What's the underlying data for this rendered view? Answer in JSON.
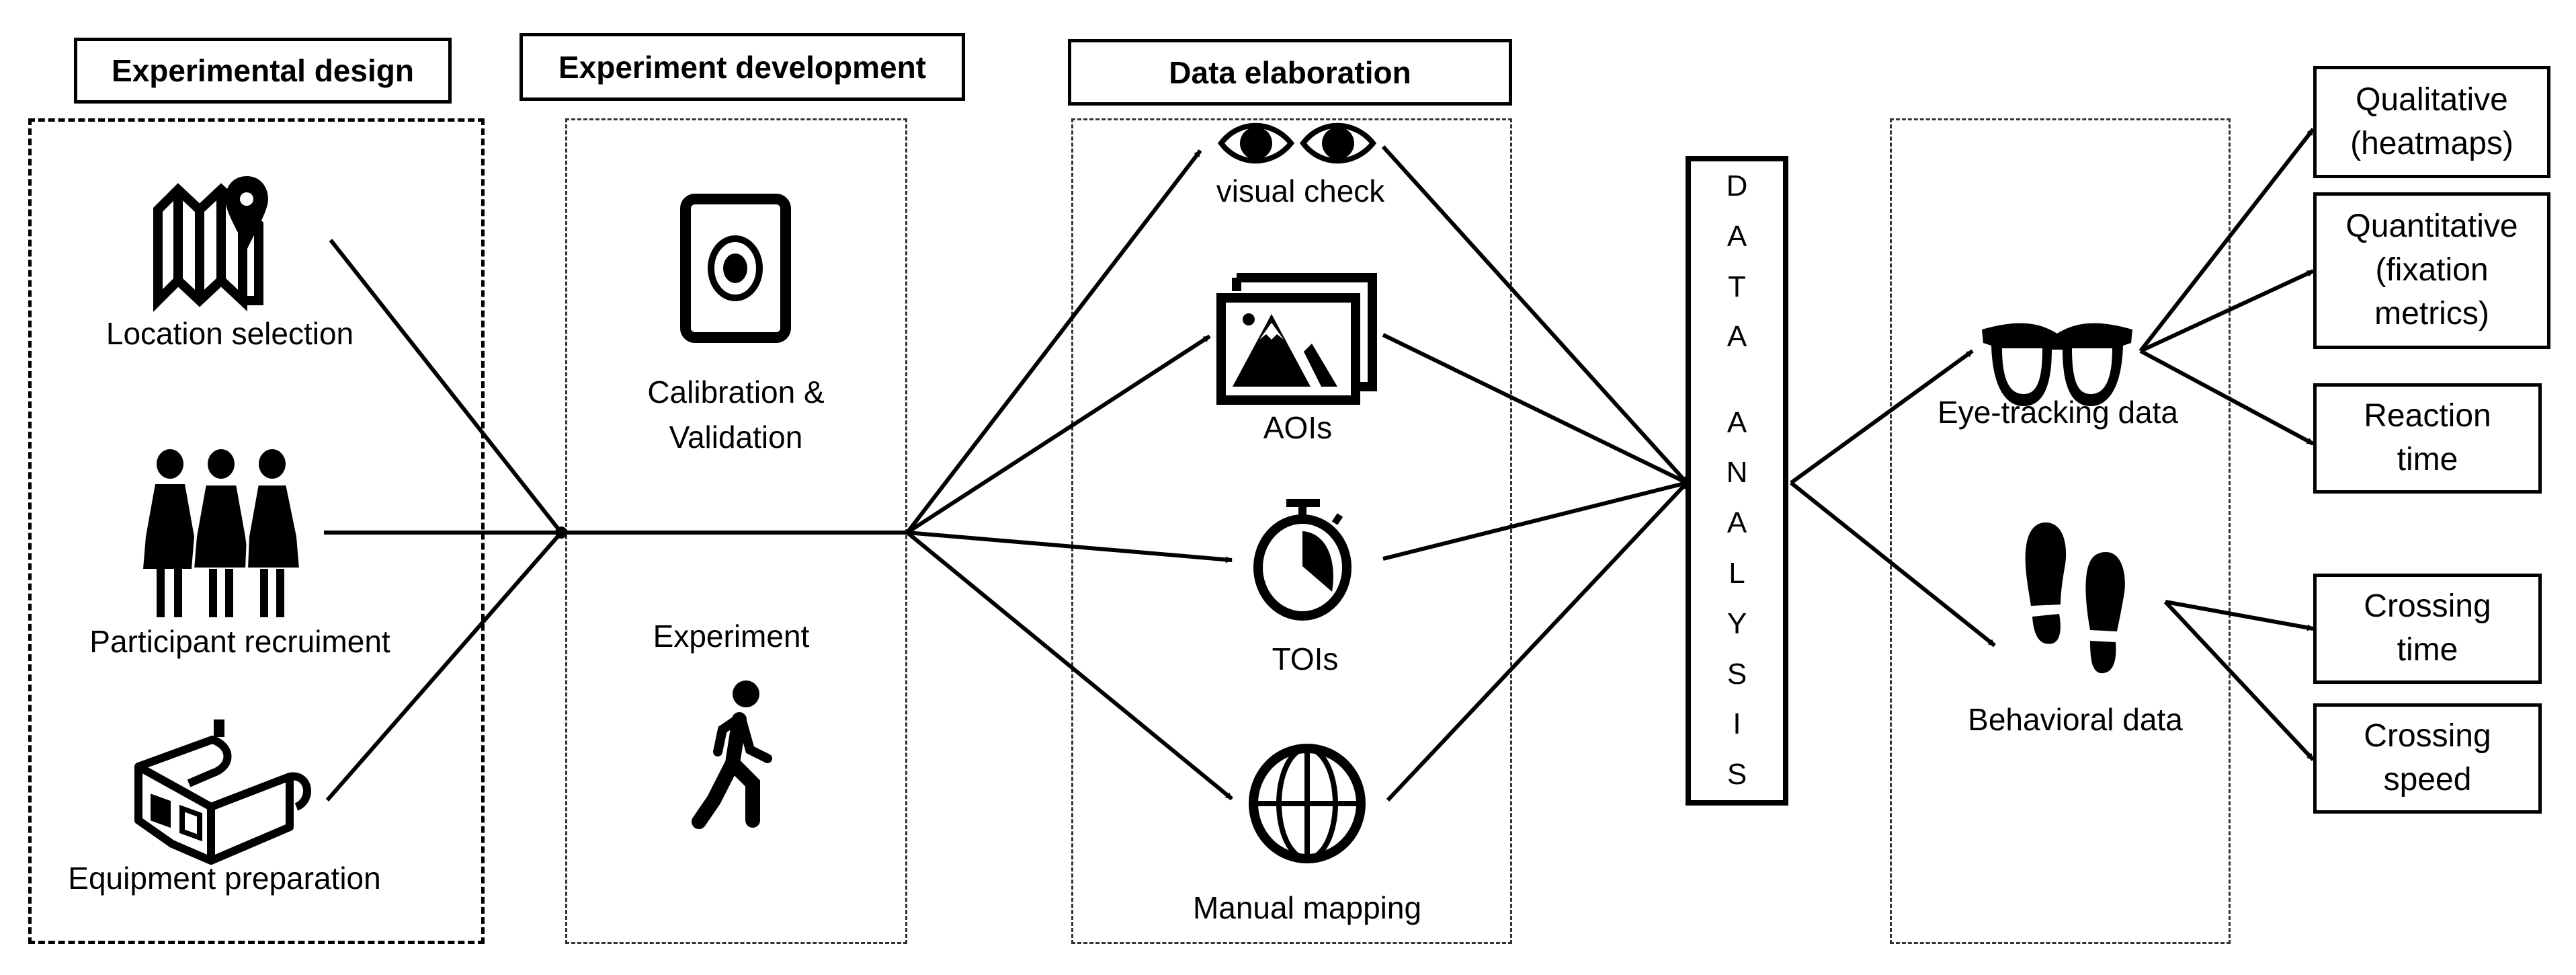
{
  "headers": {
    "experimental_design": "Experimental design",
    "experiment_development": "Experiment development",
    "data_elaboration": "Data elaboration"
  },
  "experimental_design": {
    "items": [
      {
        "label": "Location selection",
        "icon": "map-pin-icon"
      },
      {
        "label": "Participant recruiment",
        "icon": "people-icon"
      },
      {
        "label": "Equipment preparation",
        "icon": "3d-glasses-icon"
      }
    ]
  },
  "experiment_development": {
    "calibration_line1": "Calibration &",
    "calibration_line2": "Validation",
    "calibration_icon": "tablet-target-icon",
    "experiment_label": "Experiment",
    "experiment_icon": "walking-person-icon"
  },
  "data_elaboration": {
    "items": [
      {
        "label": "visual check",
        "icon": "eyes-icon"
      },
      {
        "label": "AOIs",
        "icon": "images-icon"
      },
      {
        "label": "TOIs",
        "icon": "stopwatch-icon"
      },
      {
        "label": "Manual mapping",
        "icon": "globe-icon"
      }
    ]
  },
  "data_analysis": {
    "letters": [
      "D",
      "A",
      "T",
      "A",
      "",
      "A",
      "N",
      "A",
      "L",
      "Y",
      "S",
      "I",
      "S"
    ]
  },
  "data_types": {
    "eye_tracking": {
      "label": "Eye-tracking data",
      "icon": "eyeglasses-icon"
    },
    "behavioral": {
      "label": "Behavioral data",
      "icon": "footprints-icon"
    }
  },
  "outputs": {
    "qualitative": [
      "Qualitative",
      "(heatmaps)"
    ],
    "quantitative": [
      "Quantitative",
      "(fixation",
      "metrics)"
    ],
    "reaction": [
      "Reaction",
      "time"
    ],
    "crossing_time": [
      "Crossing",
      "time"
    ],
    "crossing_speed": [
      "Crossing",
      "speed"
    ]
  }
}
